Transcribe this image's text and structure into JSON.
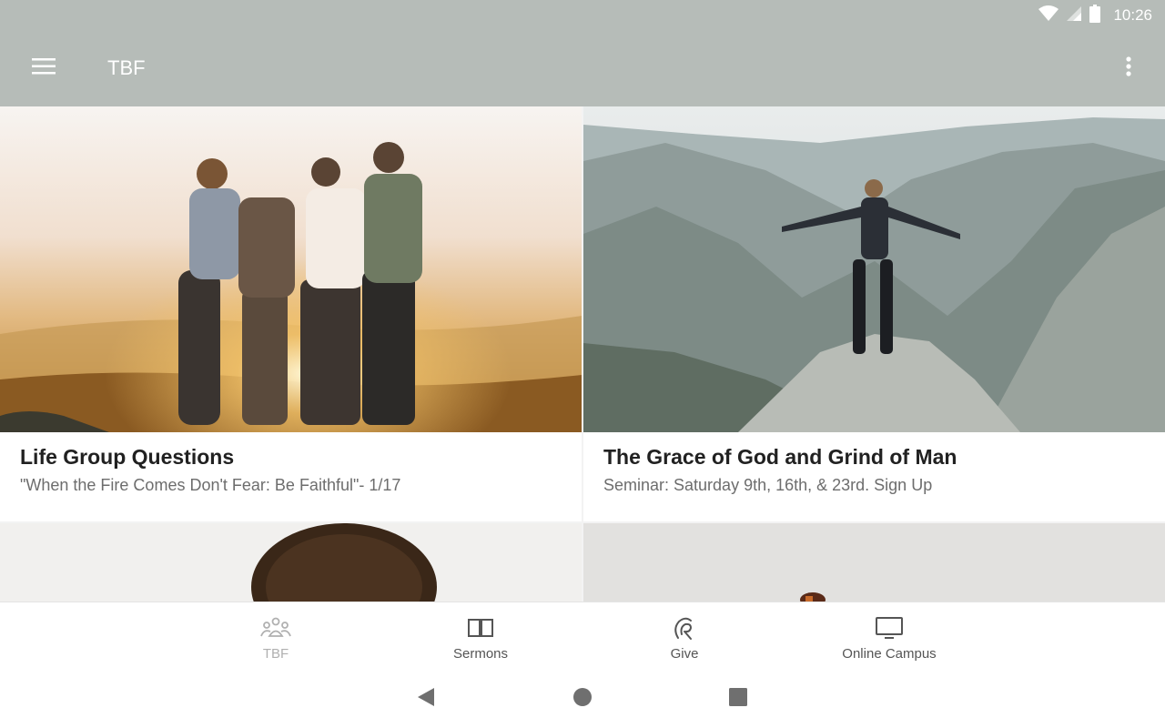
{
  "status_bar": {
    "time": "10:26"
  },
  "app_bar": {
    "title": "TBF",
    "menu_icon": "hamburger-menu-icon",
    "overflow_icon": "more-vert-icon"
  },
  "cards": [
    {
      "title": "Life Group Questions",
      "subtitle": "\"When the Fire Comes Don't Fear: Be Faithful\"- 1/17"
    },
    {
      "title": "The Grace of God and Grind of Man",
      "subtitle": "Seminar: Saturday 9th, 16th, & 23rd. Sign Up"
    }
  ],
  "bottom_nav": [
    {
      "label": "TBF",
      "icon": "group-icon",
      "active": true
    },
    {
      "label": "Sermons",
      "icon": "book-icon",
      "active": false
    },
    {
      "label": "Give",
      "icon": "give-icon",
      "active": false
    },
    {
      "label": "Online Campus",
      "icon": "monitor-icon",
      "active": false
    }
  ],
  "system_nav": {
    "back_icon": "back-triangle-icon",
    "home_icon": "home-circle-icon",
    "recents_icon": "recents-square-icon"
  },
  "colors": {
    "app_bar": "#b6bcb8",
    "accent_inactive": "#b0b0b0",
    "text_secondary": "#6d6d6d"
  }
}
